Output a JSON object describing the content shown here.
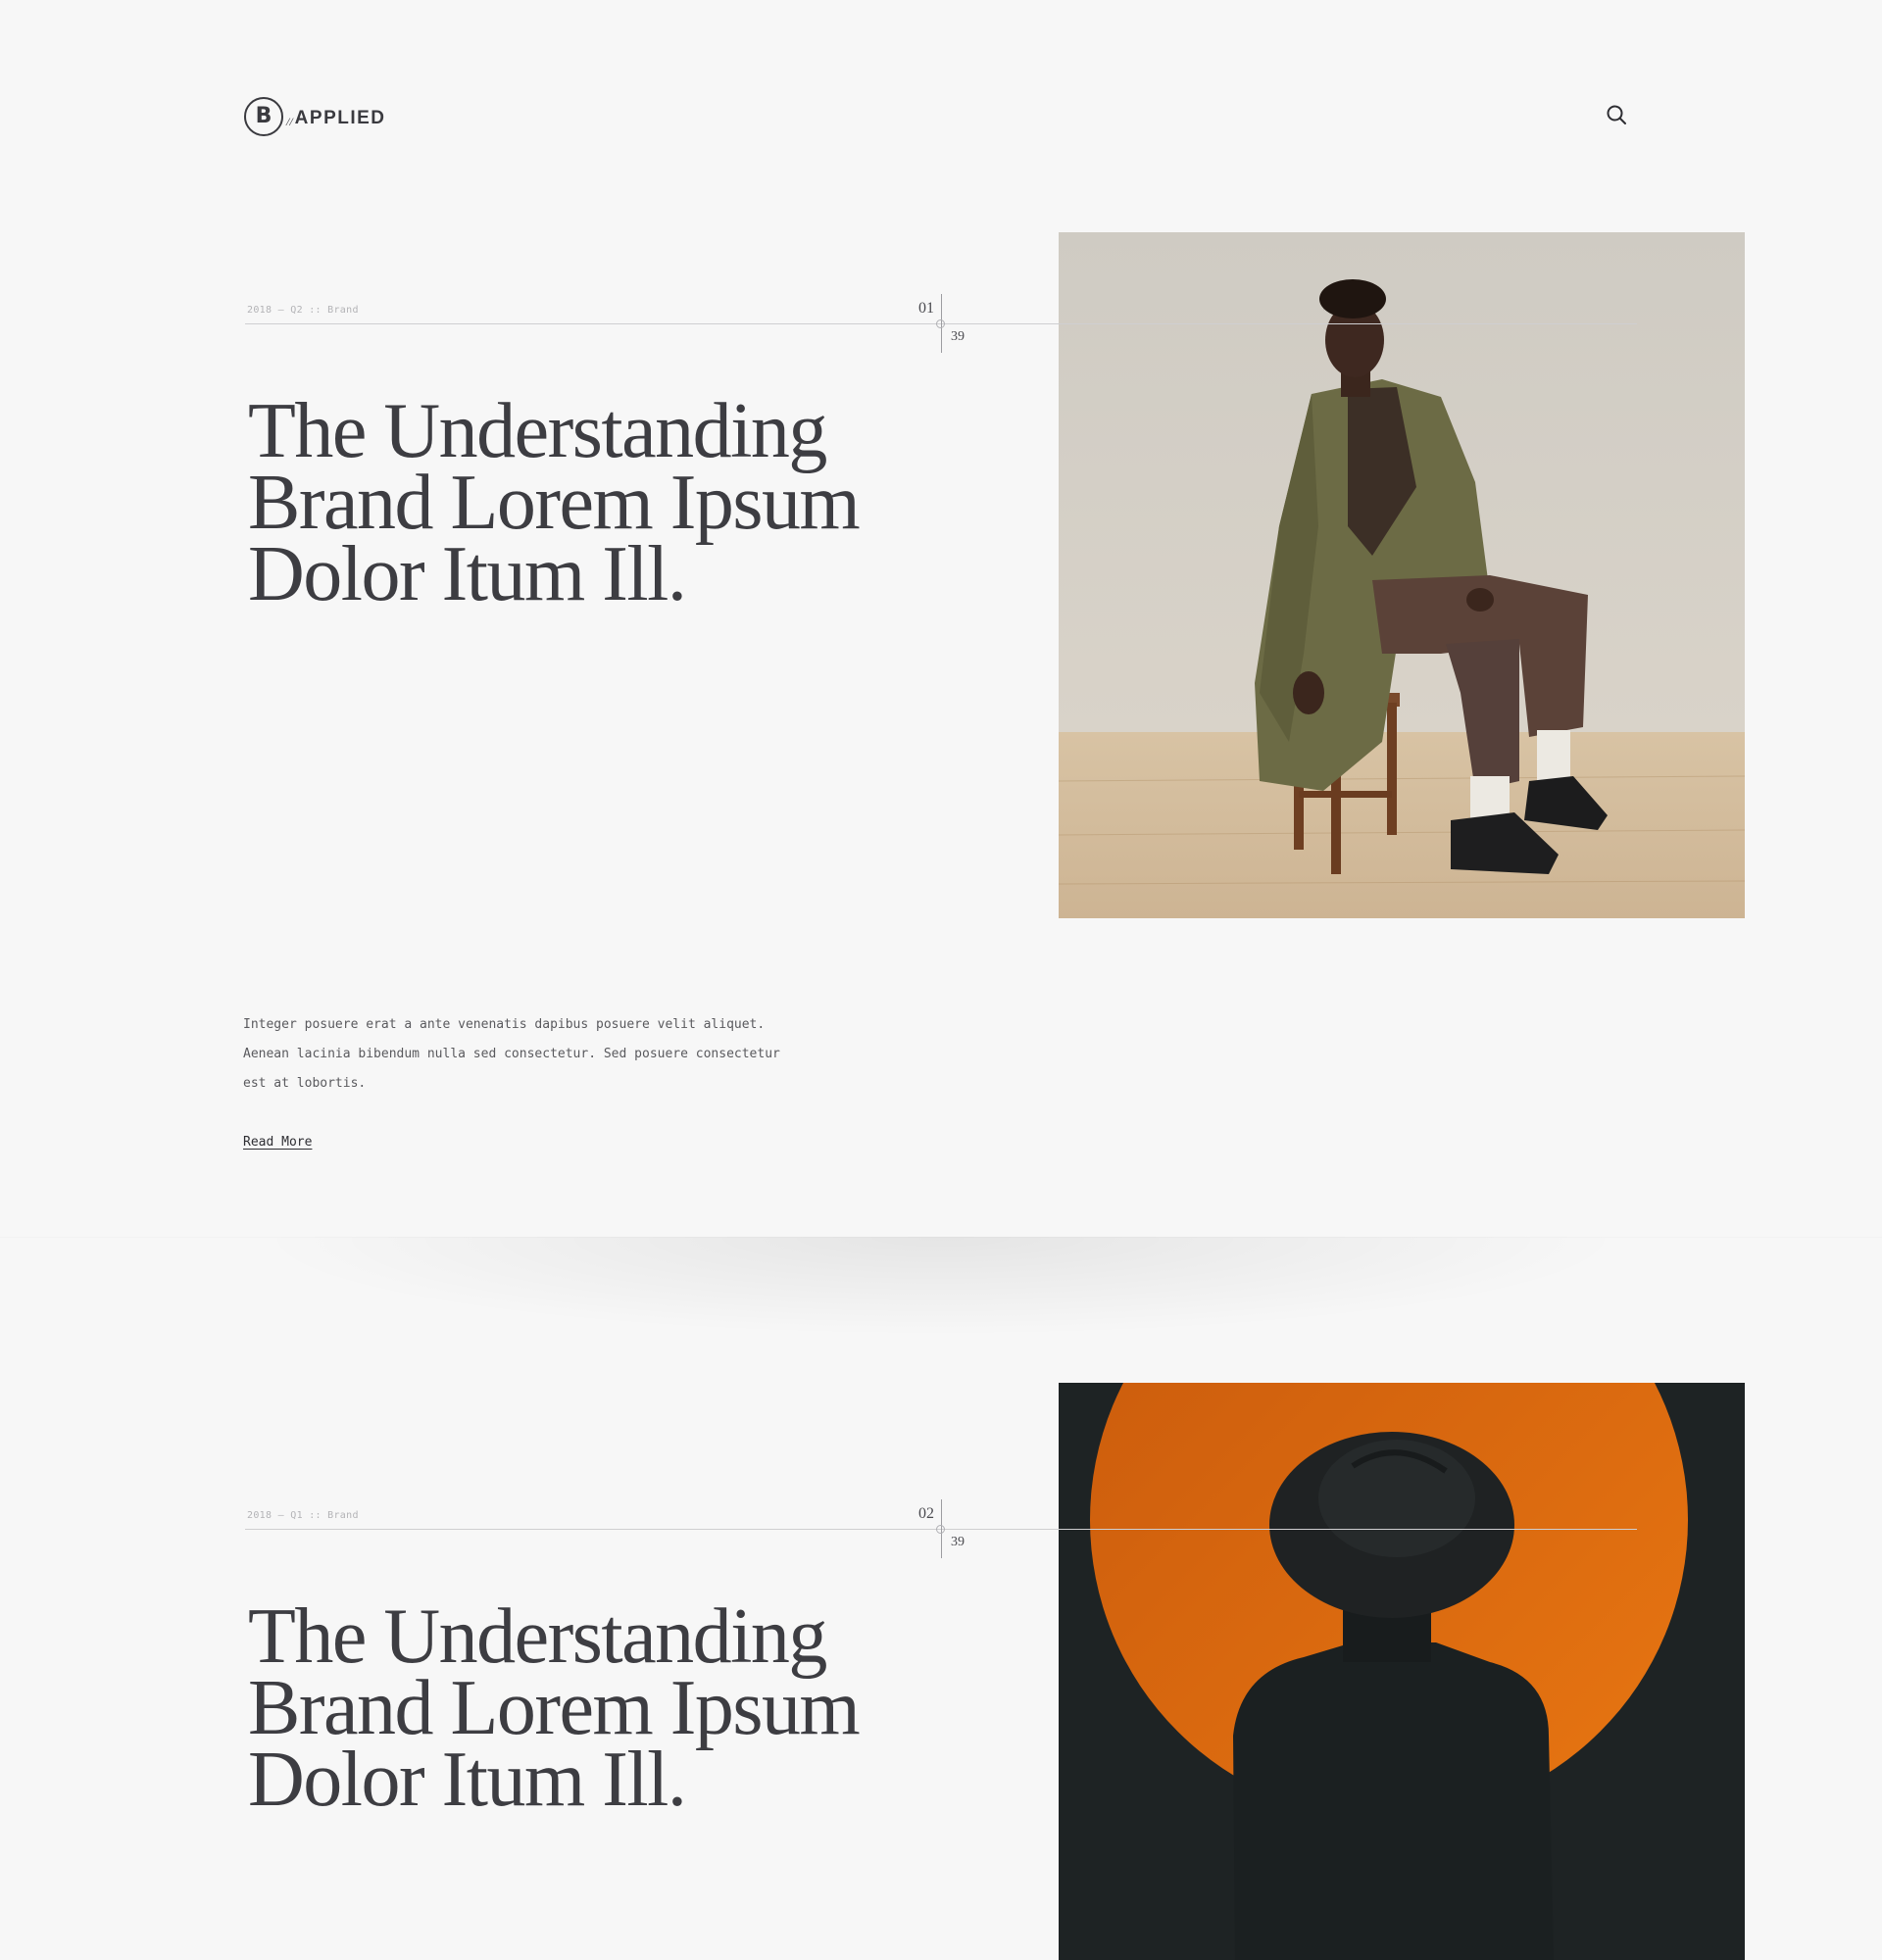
{
  "header": {
    "logo": {
      "mark": "B",
      "slash": "//",
      "text": "APPLIED"
    },
    "search_icon": "search-icon"
  },
  "articles": [
    {
      "meta": "2018 — Q2 :: Brand",
      "index": "01",
      "total": "39",
      "headline": "The Understanding Brand Lorem Ipsum Dolor Itum Ill.",
      "excerpt": "Integer posuere erat a ante venenatis dapibus posuere velit aliquet. Aenean lacinia bibendum nulla sed consectetur. Sed posuere consectetur est at lobortis.",
      "cta": "Read More",
      "image": "man-seated-on-stool-in-olive-coat"
    },
    {
      "meta": "2018 — Q1 :: Brand",
      "index": "02",
      "total": "39",
      "headline": "The Understanding Brand Lorem Ipsum Dolor Itum Ill.",
      "image": "figure-in-black-hat-before-orange-circle"
    }
  ],
  "colors": {
    "background": "#f7f7f7",
    "text": "#3d3d42",
    "accent_orange": "#e06a10",
    "dark_panel": "#1e2324"
  }
}
